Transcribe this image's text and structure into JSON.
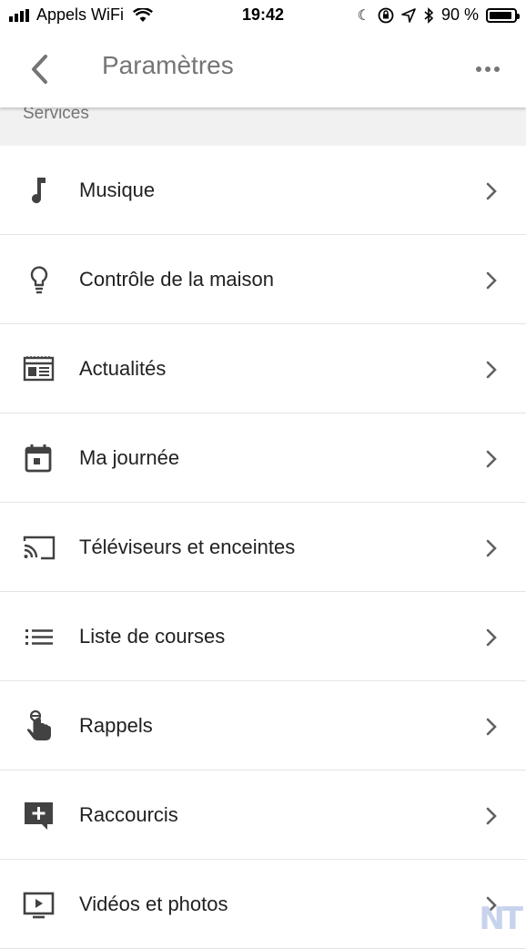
{
  "status_bar": {
    "carrier": "Appels WiFi",
    "time": "19:42",
    "battery": "90 %"
  },
  "app_bar": {
    "title": "Paramètres",
    "back_icon": "chevron-left-icon",
    "more_icon": "more-horizontal-icon"
  },
  "section": {
    "label": "Services"
  },
  "items": [
    {
      "label": "Musique",
      "icon": "music-note-icon"
    },
    {
      "label": "Contrôle de la maison",
      "icon": "lightbulb-icon"
    },
    {
      "label": "Actualités",
      "icon": "newspaper-icon"
    },
    {
      "label": "Ma journée",
      "icon": "calendar-icon"
    },
    {
      "label": "Téléviseurs et enceintes",
      "icon": "cast-icon"
    },
    {
      "label": "Liste de courses",
      "icon": "list-icon"
    },
    {
      "label": "Rappels",
      "icon": "reminder-finger-icon"
    },
    {
      "label": "Raccourcis",
      "icon": "add-shortcut-icon"
    },
    {
      "label": "Vidéos et photos",
      "icon": "video-play-icon"
    }
  ],
  "watermark": "NT",
  "colors": {
    "icon": "#424242",
    "text": "#212121",
    "title": "#757575",
    "divider": "#e4e4e4",
    "section_bg": "#f1f1f1"
  }
}
